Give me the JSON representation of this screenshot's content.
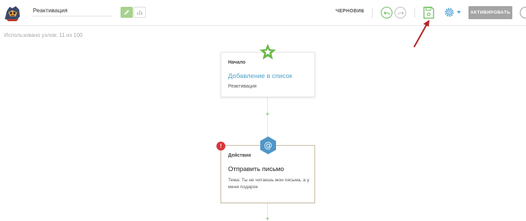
{
  "header": {
    "title_value": "Реактивация",
    "status": {
      "label": "ЧЕРНОВИК"
    },
    "activate_label": "АКТИВИРОВАТЬ",
    "icons": [
      "logo-mascot",
      "edit-pencil",
      "stats-chart",
      "undo-arrow",
      "redo-arrow",
      "save-floppy",
      "settings-gear"
    ]
  },
  "usage": {
    "text": "Использовано узлов: 11 из 100"
  },
  "colors": {
    "accent_green": "#66bb55",
    "accent_blue": "#5aa6d8",
    "link_blue": "#4ea3c9",
    "error_red": "#d9363b",
    "arrow_red": "#b32626",
    "disabled_gray": "#a4a4a4"
  },
  "flow": {
    "start_node": {
      "kicker": "Начало",
      "link": "Добавление в список",
      "subtitle": "Реактивация",
      "icon": "star-icon"
    },
    "action_node": {
      "kicker": "Действия",
      "title": "Отправить письмо",
      "description": "Тема: Ты не читаешь мои письма, а у меня подарок",
      "icon": "at-icon",
      "error_badge": "!"
    },
    "plus_symbol": "+"
  }
}
